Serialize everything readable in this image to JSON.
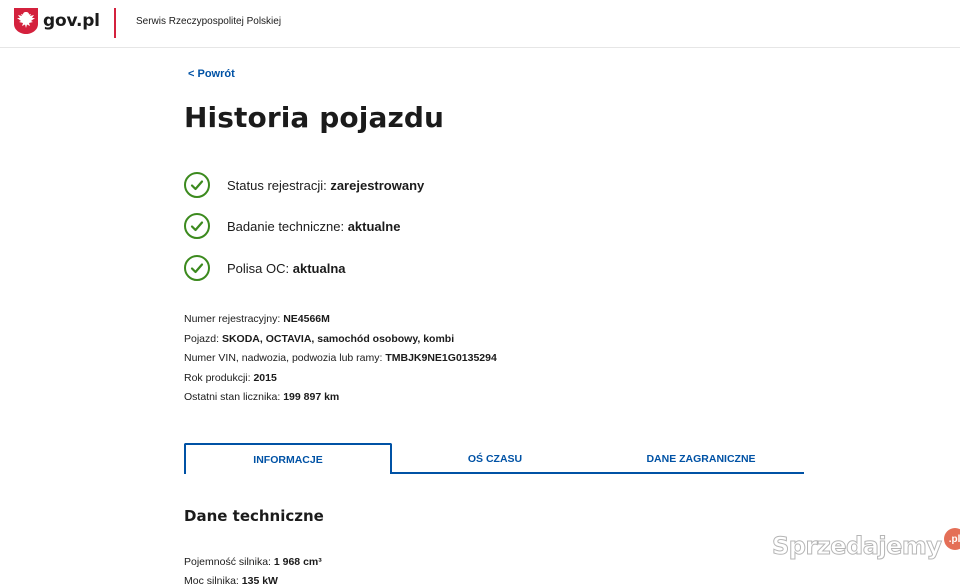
{
  "header": {
    "logo_text": "gov.pl",
    "service_name": "Serwis Rzeczypospolitej Polskiej",
    "accent_color": "#d4213d"
  },
  "back_link": "< Powrót",
  "page_title": "Historia pojazdu",
  "statuses": [
    {
      "label": "Status rejestracji: ",
      "value": "zarejestrowany",
      "icon": "check-circle-icon"
    },
    {
      "label": "Badanie techniczne: ",
      "value": "aktualne",
      "icon": "check-circle-icon"
    },
    {
      "label": "Polisa OC: ",
      "value": "aktualna",
      "icon": "check-circle-icon"
    }
  ],
  "status_color": "#3c8a1e",
  "vehicle": [
    {
      "label": "Numer rejestracyjny: ",
      "value": "NE4566M"
    },
    {
      "label": "Pojazd: ",
      "value": "SKODA, OCTAVIA, samochód osobowy, kombi"
    },
    {
      "label": "Numer VIN, nadwozia, podwozia lub ramy: ",
      "value": "TMBJK9NE1G0135294"
    },
    {
      "label": "Rok produkcji: ",
      "value": "2015"
    },
    {
      "label": "Ostatni stan licznika: ",
      "value": "199 897 km"
    }
  ],
  "tabs": [
    {
      "label": "INFORMACJE",
      "active": true
    },
    {
      "label": "OŚ CZASU",
      "active": false
    },
    {
      "label": "DANE ZAGRANICZNE",
      "active": false
    }
  ],
  "tab_color": "#0052a5",
  "section_title": "Dane techniczne",
  "tech": [
    {
      "label": "Pojemność silnika: ",
      "value": "1 968 cm³"
    },
    {
      "label": "Moc silnika: ",
      "value": "135 kW"
    }
  ],
  "watermark": {
    "text": "Sprzedajemy",
    "badge": ".pl"
  }
}
